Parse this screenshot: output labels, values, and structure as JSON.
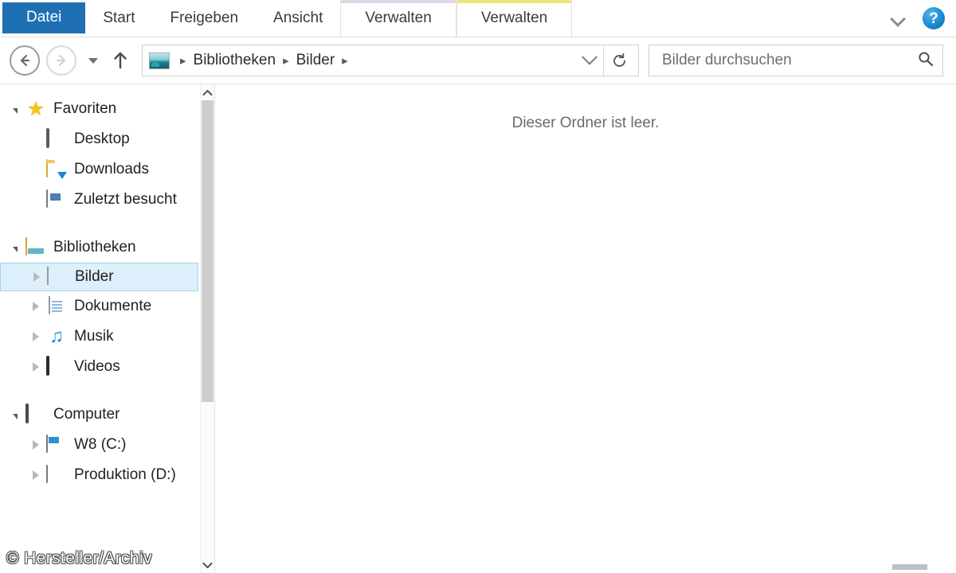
{
  "window": {
    "title": "Bilder",
    "watermark": "© Hersteller/Archiv"
  },
  "colors": {
    "file_tab_blue": "#1f6fb5",
    "selection_fill": "#ddeffa",
    "selection_border": "#a6d4ea",
    "contextual_lavender": "#ded7e8",
    "contextual_yellow": "#efe67a",
    "help_blue": "#1b8ad4"
  },
  "ribbon": {
    "file_tab": "Datei",
    "tabs": [
      {
        "label": "Start"
      },
      {
        "label": "Freigeben"
      },
      {
        "label": "Ansicht"
      }
    ],
    "contextual_tabs": [
      {
        "label": "Verwalten",
        "strip": "lavender",
        "active": false
      },
      {
        "label": "Verwalten",
        "strip": "yellow",
        "active": true
      }
    ],
    "expand_icon": "chevron-down-icon",
    "help_icon": "help-icon",
    "help_glyph": "?"
  },
  "addressbar": {
    "back_icon": "back-arrow-icon",
    "forward_icon": "forward-arrow-icon",
    "history_icon": "recent-locations-caret-icon",
    "up_icon": "up-arrow-icon",
    "location_icon": "pictures-library-icon",
    "separator": "▸",
    "crumbs": [
      {
        "label": "Bibliotheken"
      },
      {
        "label": "Bilder"
      }
    ],
    "dropdown_icon": "chevron-down-icon",
    "refresh_icon": "refresh-icon",
    "refresh_glyph": "↻"
  },
  "search": {
    "placeholder": "Bilder durchsuchen",
    "value": "",
    "icon": "search-icon"
  },
  "navpane": {
    "groups": [
      {
        "name": "favoriten-group",
        "header": {
          "label": "Favoriten",
          "icon": "star-icon",
          "expander": "open"
        },
        "items": [
          {
            "label": "Desktop",
            "icon": "desktop-icon",
            "expander": "none"
          },
          {
            "label": "Downloads",
            "icon": "downloads-folder-icon",
            "expander": "none"
          },
          {
            "label": "Zuletzt besucht",
            "icon": "recent-places-icon",
            "expander": "none"
          }
        ]
      },
      {
        "name": "bibliotheken-group",
        "header": {
          "label": "Bibliotheken",
          "icon": "library-folder-icon",
          "expander": "open"
        },
        "items": [
          {
            "label": "Bilder",
            "icon": "pictures-library-icon",
            "expander": "closed",
            "selected": true
          },
          {
            "label": "Dokumente",
            "icon": "documents-library-icon",
            "expander": "closed",
            "selected": false
          },
          {
            "label": "Musik",
            "icon": "music-library-icon",
            "expander": "closed",
            "selected": false
          },
          {
            "label": "Videos",
            "icon": "videos-library-icon",
            "expander": "closed",
            "selected": false
          }
        ]
      },
      {
        "name": "computer-group",
        "header": {
          "label": "Computer",
          "icon": "computer-icon",
          "expander": "open"
        },
        "items": [
          {
            "label": "W8 (C:)",
            "icon": "system-drive-icon",
            "expander": "closed"
          },
          {
            "label": "Produktion (D:)",
            "icon": "drive-icon",
            "expander": "closed"
          }
        ]
      }
    ],
    "scrollbar": {
      "up_icon": "scroll-up-icon",
      "down_icon": "scroll-down-icon",
      "thumb_position": "top"
    }
  },
  "content": {
    "empty_message": "Dieser Ordner ist leer."
  }
}
